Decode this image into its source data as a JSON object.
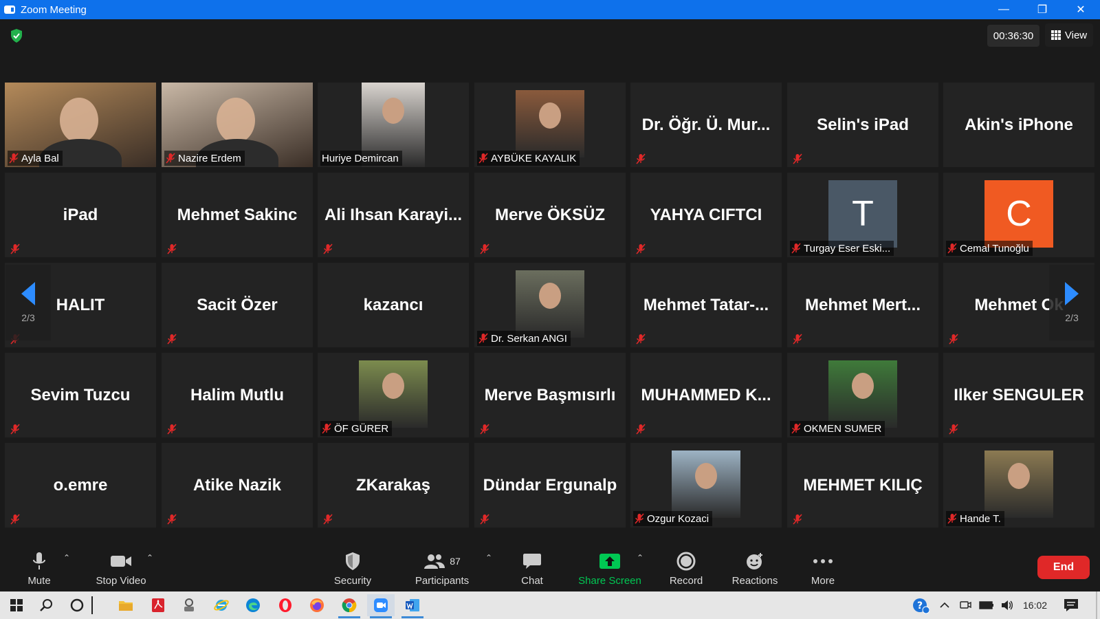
{
  "window": {
    "title": "Zoom Meeting"
  },
  "meeting": {
    "timer": "00:36:30",
    "view_label": "View"
  },
  "pager": {
    "left": "2/3",
    "right": "2/3"
  },
  "tiles": [
    {
      "name": "Ayla Bal",
      "kind": "video",
      "muted": true,
      "photo_color": "#b48a5a"
    },
    {
      "name": "Nazire Erdem",
      "kind": "video",
      "muted": true,
      "photo_color": "#c9b8a6"
    },
    {
      "name": "Huriye Demircan",
      "kind": "photo",
      "muted": false,
      "photo_color": "#d9d4cf"
    },
    {
      "name": "AYBÜKE KAYALIK",
      "kind": "photo",
      "muted": true,
      "photo_color": "#8a5a3c"
    },
    {
      "name": "Dr. Öğr. Ü. Mur...",
      "kind": "text",
      "muted": true
    },
    {
      "name": "Selin's iPad",
      "kind": "text",
      "muted": true
    },
    {
      "name": "Akin's iPhone",
      "kind": "text",
      "muted": false
    },
    {
      "name": "iPad",
      "kind": "text",
      "muted": true
    },
    {
      "name": "Mehmet Sakinc",
      "kind": "text",
      "muted": true
    },
    {
      "name": "Ali Ihsan Karayi...",
      "kind": "text",
      "muted": true
    },
    {
      "name": "Merve ÖKSÜZ",
      "kind": "text",
      "muted": true
    },
    {
      "name": "YAHYA CIFTCI",
      "kind": "text",
      "muted": true
    },
    {
      "name": "Turgay Eser Eski...",
      "kind": "letter",
      "letter": "T",
      "letter_bg": "#4a5866",
      "muted": true
    },
    {
      "name": "Cemal Tunoğlu",
      "kind": "letter",
      "letter": "C",
      "letter_bg": "#f05a22",
      "muted": true
    },
    {
      "name": "HALIT",
      "kind": "text",
      "muted": true
    },
    {
      "name": "Sacit Özer",
      "kind": "text",
      "muted": true
    },
    {
      "name": "kazancı",
      "kind": "text",
      "muted": false
    },
    {
      "name": "Dr. Serkan ANGI",
      "kind": "photo",
      "muted": true,
      "photo_color": "#6b6e5e"
    },
    {
      "name": "Mehmet Tatar-...",
      "kind": "text",
      "muted": true
    },
    {
      "name": "Mehmet Mert...",
      "kind": "text",
      "muted": true
    },
    {
      "name": "Mehmet Ok",
      "kind": "text",
      "muted": true
    },
    {
      "name": "Sevim Tuzcu",
      "kind": "text",
      "muted": true
    },
    {
      "name": "Halim Mutlu",
      "kind": "text",
      "muted": true
    },
    {
      "name": "ÖF GÜRER",
      "kind": "photo",
      "muted": true,
      "photo_color": "#7c8c4e"
    },
    {
      "name": "Merve Başmısırlı",
      "kind": "text",
      "muted": true
    },
    {
      "name": "MUHAMMED K...",
      "kind": "text",
      "muted": true
    },
    {
      "name": "OKMEN SUMER",
      "kind": "photo",
      "muted": true,
      "photo_color": "#3f7a3a"
    },
    {
      "name": "Ilker SENGULER",
      "kind": "text",
      "muted": true
    },
    {
      "name": "o.emre",
      "kind": "text",
      "muted": true
    },
    {
      "name": "Atike Nazik",
      "kind": "text",
      "muted": true
    },
    {
      "name": "ZKarakaş",
      "kind": "text",
      "muted": true
    },
    {
      "name": "Dündar Ergunalp",
      "kind": "text",
      "muted": true
    },
    {
      "name": "Ozgur Kozaci",
      "kind": "photo",
      "muted": true,
      "photo_color": "#9db3c4"
    },
    {
      "name": "MEHMET KILIÇ",
      "kind": "text",
      "muted": true
    },
    {
      "name": "Hande T.",
      "kind": "photo",
      "muted": true,
      "photo_color": "#8c7a52"
    }
  ],
  "toolbar": {
    "mute": "Mute",
    "stop_video": "Stop Video",
    "security": "Security",
    "participants": "Participants",
    "participants_count": "87",
    "chat": "Chat",
    "share_screen": "Share Screen",
    "record": "Record",
    "reactions": "Reactions",
    "more": "More",
    "end": "End"
  },
  "taskbar": {
    "clock": "16:02"
  },
  "colors": {
    "accent": "#0e71eb",
    "share_green": "#00c853",
    "end_red": "#e02828",
    "muted_red": "#e02828"
  }
}
